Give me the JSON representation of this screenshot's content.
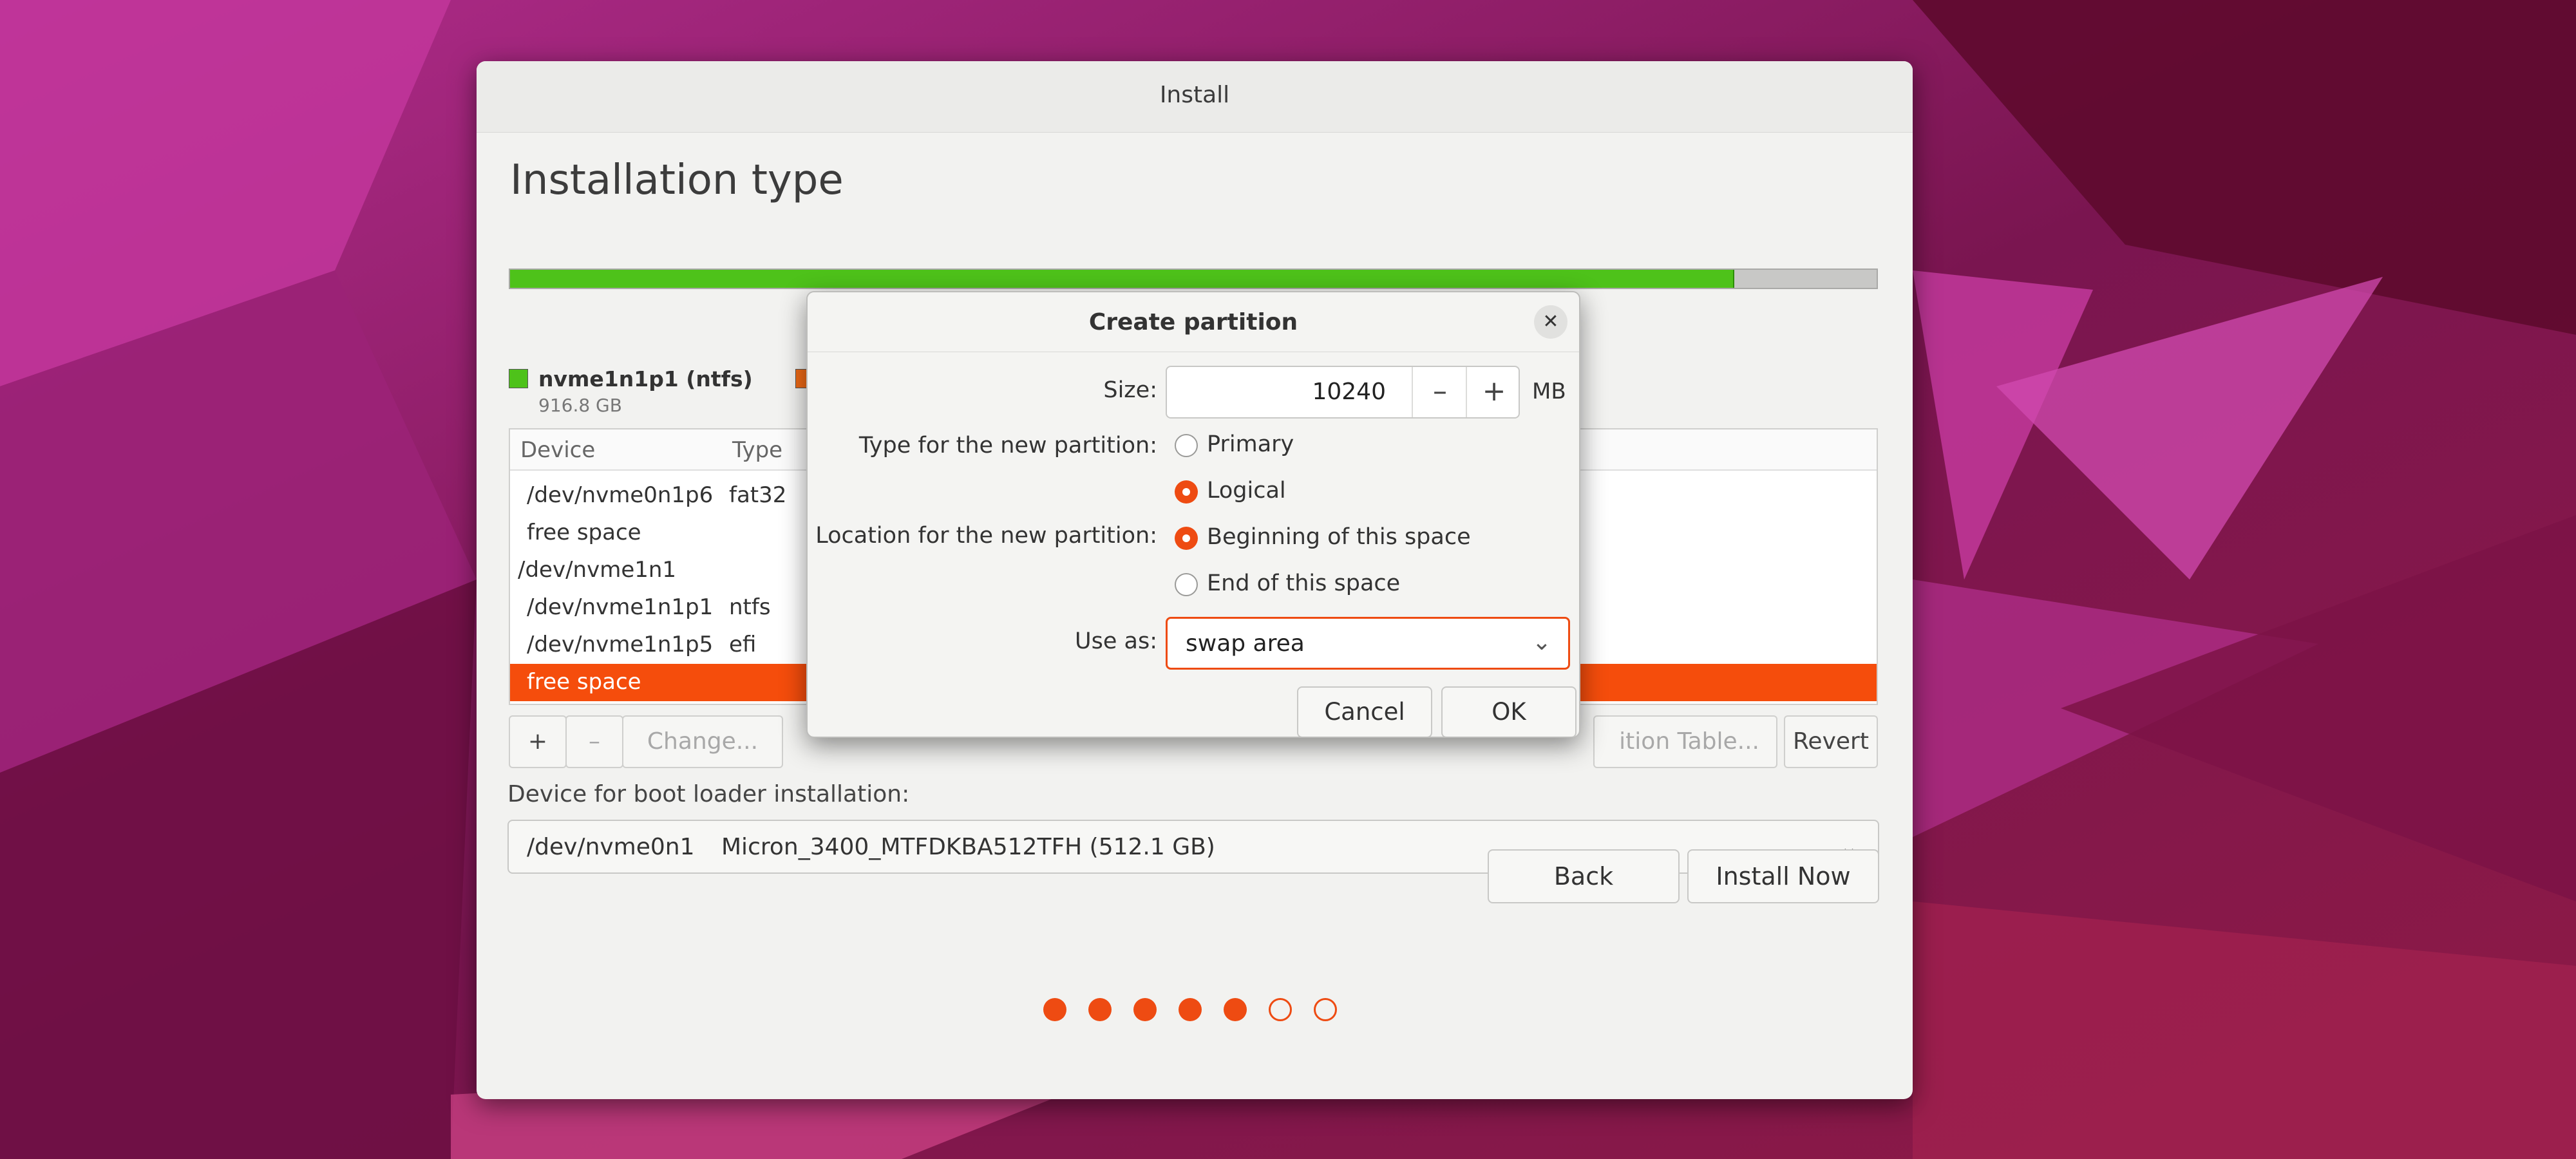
{
  "window": {
    "title": "Install"
  },
  "page_title": "Installation type",
  "usage": {
    "fill_fraction": 0.895,
    "used_color": "#4ec21a",
    "free_color": "#c8c8c6"
  },
  "legend": [
    {
      "name": "nvme1n1p1 (ntfs)",
      "size": "916.8 GB",
      "color": "#4ec21a"
    },
    {
      "name": "",
      "size": "",
      "color": "#f06a16"
    }
  ],
  "table": {
    "headers": [
      "Device",
      "Type"
    ],
    "rows": [
      {
        "device": "/dev/nvme0n1p6",
        "type": "fat32",
        "selected": false
      },
      {
        "device": "free space",
        "type": "",
        "selected": false
      },
      {
        "device": "/dev/nvme1n1",
        "type": "",
        "selected": false
      },
      {
        "device": "/dev/nvme1n1p1",
        "type": "ntfs",
        "selected": false
      },
      {
        "device": "/dev/nvme1n1p5",
        "type": "efi",
        "selected": false
      },
      {
        "device": "free space",
        "type": "",
        "selected": true
      }
    ]
  },
  "table_buttons": {
    "add": "+",
    "remove": "–",
    "change": "Change...",
    "new_table": "ition Table...",
    "revert": "Revert"
  },
  "bootloader": {
    "label": "Device for boot loader installation:",
    "device": "/dev/nvme0n1",
    "model": "Micron_3400_MTFDKBA512TFH (512.1 GB)",
    "chevron_icon": "chevron-down-icon"
  },
  "nav": {
    "back": "Back",
    "install_now": "Install Now"
  },
  "progress": {
    "total_steps": 7,
    "completed_steps": 5,
    "accent": "#ee4b12"
  },
  "dialog": {
    "title": "Create partition",
    "close_icon": "close-icon",
    "size_label": "Size:",
    "size_value": "10240",
    "size_unit": "MB",
    "decrement": "–",
    "increment": "+",
    "type_label": "Type for the new partition:",
    "type_options": [
      {
        "label": "Primary",
        "selected": false
      },
      {
        "label": "Logical",
        "selected": true
      }
    ],
    "location_label": "Location for the new partition:",
    "location_options": [
      {
        "label": "Beginning of this space",
        "selected": true
      },
      {
        "label": "End of this space",
        "selected": false
      }
    ],
    "use_as_label": "Use as:",
    "use_as_value": "swap area",
    "cancel": "Cancel",
    "ok": "OK"
  }
}
